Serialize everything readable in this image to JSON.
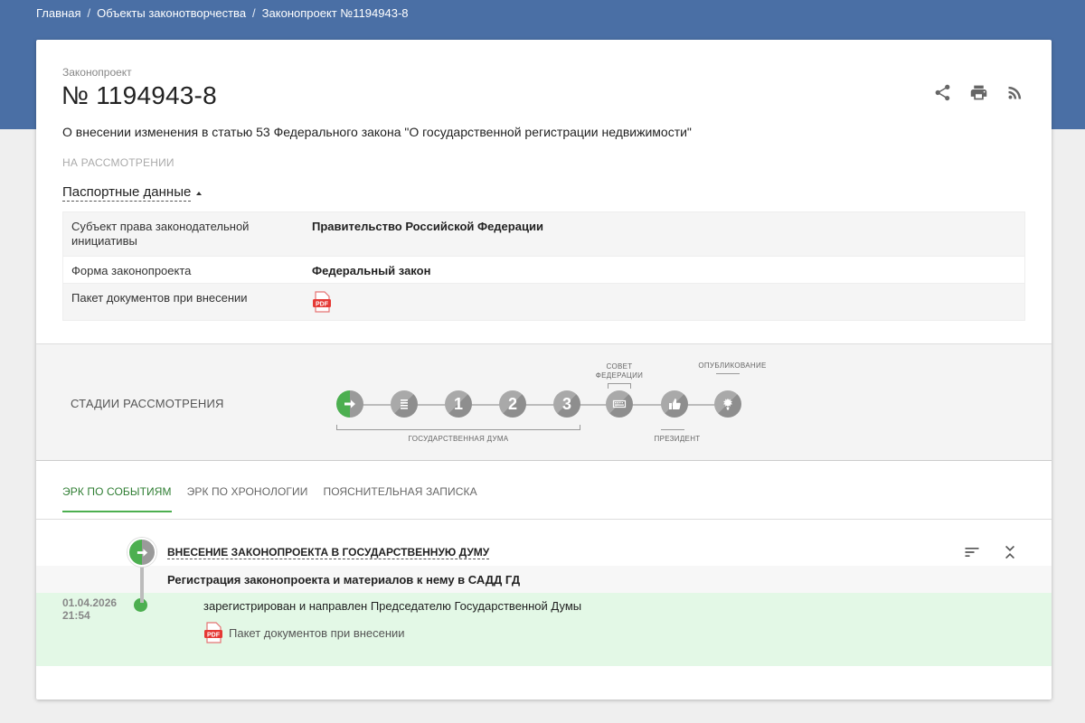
{
  "breadcrumb": {
    "items": [
      {
        "label": "Главная"
      },
      {
        "label": "Объекты законотворчества"
      },
      {
        "label": "Законопроект №1194943-8"
      }
    ],
    "separator": "/"
  },
  "bill": {
    "kind": "Законопроект",
    "number": "№ 1194943-8",
    "title": "О внесении изменения в статью 53 Федерального закона \"О государственной регистрации недвижимости\"",
    "status": "НА РАССМОТРЕНИИ"
  },
  "actions": {
    "icons": [
      "share-icon",
      "print-icon",
      "rss-icon"
    ]
  },
  "passport": {
    "toggle_label": "Паспортные данные",
    "rows": [
      {
        "key": "Субъект права законодательной инициативы",
        "value": "Правительство Российской Федерации"
      },
      {
        "key": "Форма законопроекта",
        "value": "Федеральный закон"
      },
      {
        "key": "Пакет документов при внесении",
        "value_icon": "pdf-icon"
      }
    ]
  },
  "pdf_label": "PDF",
  "stages": {
    "label": "СТАДИИ РАССМОТРЕНИЯ",
    "items": [
      {
        "kind": "icon",
        "icon": "arrow-right-icon",
        "active": true
      },
      {
        "kind": "icon",
        "icon": "list-icon",
        "active": false
      },
      {
        "kind": "number",
        "text": "1",
        "active": false
      },
      {
        "kind": "number",
        "text": "2",
        "active": false
      },
      {
        "kind": "number",
        "text": "3",
        "active": false
      },
      {
        "kind": "icon",
        "icon": "keyboard-icon",
        "active": false
      },
      {
        "kind": "icon",
        "icon": "approve-icon",
        "active": false
      },
      {
        "kind": "icon",
        "icon": "emblem-icon",
        "active": false
      }
    ],
    "groups": {
      "duma": "ГОСУДАРСТВЕННАЯ ДУМА",
      "federation_council": "СОВЕТ ФЕДЕРАЦИИ",
      "president": "ПРЕЗИДЕНТ",
      "publication": "ОПУБЛИКОВАНИЕ"
    }
  },
  "tabs": [
    {
      "label": "ЭРК ПО СОБЫТИЯМ",
      "active": true
    },
    {
      "label": "ЭРК ПО ХРОНОЛОГИИ",
      "active": false
    },
    {
      "label": "ПОЯСНИТЕЛЬНАЯ ЗАПИСКА",
      "active": false
    }
  ],
  "timeline": {
    "stage_title": "ВНЕСЕНИЕ ЗАКОНОПРОЕКТА В ГОСУДАРСТВЕННУЮ ДУМУ",
    "tools": [
      "sort-icon",
      "collapse-icon"
    ],
    "event_group": "Регистрация законопроекта и материалов к нему в САДД ГД",
    "event": {
      "date": "01.04.2026",
      "time": "21:54",
      "text": "зарегистрирован и направлен Председателю Государственной Думы",
      "doc_label": "Пакет документов при внесении"
    }
  },
  "colors": {
    "header_band": "#4a6fa5",
    "accent_green": "#4caf50",
    "event_bg": "#e3f8e6"
  }
}
